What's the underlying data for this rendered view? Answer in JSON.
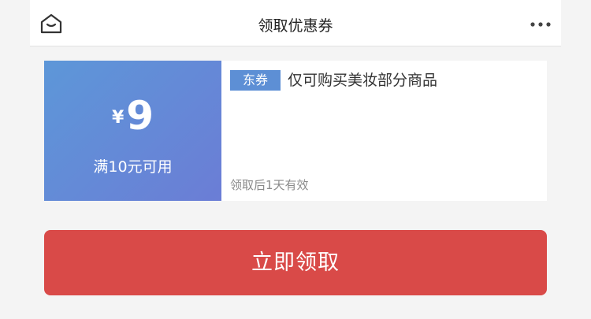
{
  "header": {
    "title": "领取优惠券",
    "home_icon": "home-icon",
    "more_icon": "more-dots-icon"
  },
  "coupon": {
    "currency": "¥",
    "amount": "9",
    "condition": "满10元可用",
    "tag": "东券",
    "description": "仅可购买美妆部分商品",
    "validity": "领取后1天有效"
  },
  "actions": {
    "claim_label": "立即领取"
  },
  "colors": {
    "coupon_gradient_start": "#5d97d8",
    "coupon_gradient_end": "#6b7dd6",
    "tag_bg": "#5d8fd5",
    "claim_button": "#d94a48"
  }
}
